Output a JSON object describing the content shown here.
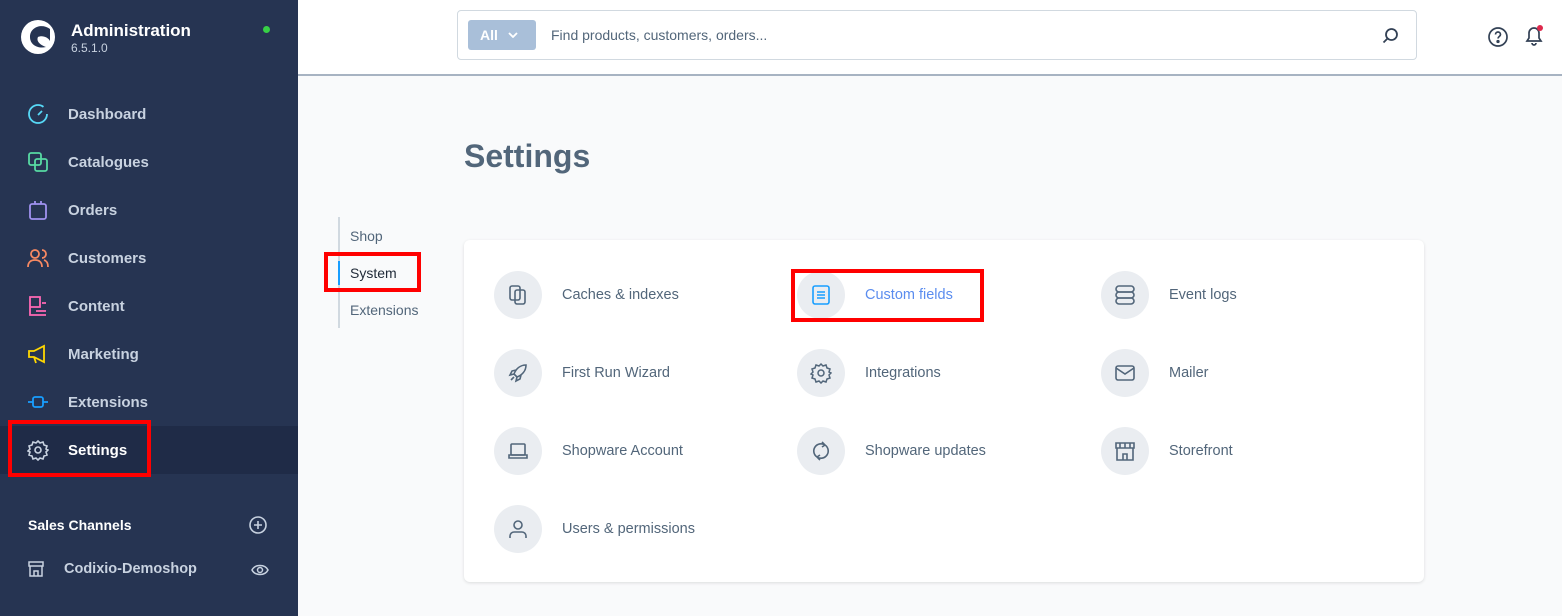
{
  "app": {
    "title": "Administration",
    "version": "6.5.1.0",
    "status_color": "#37d046"
  },
  "sidebar": {
    "items": [
      {
        "label": "Dashboard",
        "icon": "dashboard-icon",
        "color": "#57d9f7"
      },
      {
        "label": "Catalogues",
        "icon": "catalogues-icon",
        "color": "#57d9a3"
      },
      {
        "label": "Orders",
        "icon": "orders-icon",
        "color": "#a092f0"
      },
      {
        "label": "Customers",
        "icon": "customers-icon",
        "color": "#f88962"
      },
      {
        "label": "Content",
        "icon": "content-icon",
        "color": "#ff68b4"
      },
      {
        "label": "Marketing",
        "icon": "marketing-icon",
        "color": "#ffd700"
      },
      {
        "label": "Extensions",
        "icon": "extensions-icon",
        "color": "#189eff"
      },
      {
        "label": "Settings",
        "icon": "gear-icon",
        "color": "#c8d2e0",
        "active": true
      }
    ],
    "sales_channels": {
      "title": "Sales Channels",
      "items": [
        {
          "label": "Codixio-Demoshop"
        }
      ]
    }
  },
  "header": {
    "search": {
      "type": "All",
      "placeholder": "Find products, customers, orders..."
    }
  },
  "main": {
    "title": "Settings",
    "tabs": [
      {
        "label": "Shop"
      },
      {
        "label": "System",
        "active": true
      },
      {
        "label": "Extensions"
      }
    ],
    "tiles": [
      {
        "label": "Caches & indexes",
        "icon": "caches-icon"
      },
      {
        "label": "Custom fields",
        "icon": "custom-fields-icon",
        "highlighted": true
      },
      {
        "label": "Event logs",
        "icon": "event-logs-icon"
      },
      {
        "label": "First Run Wizard",
        "icon": "rocket-icon"
      },
      {
        "label": "Integrations",
        "icon": "gear-icon"
      },
      {
        "label": "Mailer",
        "icon": "mail-icon"
      },
      {
        "label": "Shopware Account",
        "icon": "laptop-icon"
      },
      {
        "label": "Shopware updates",
        "icon": "refresh-icon"
      },
      {
        "label": "Storefront",
        "icon": "storefront-icon"
      },
      {
        "label": "Users & permissions",
        "icon": "user-icon"
      }
    ]
  },
  "accent": "#189eff",
  "highlight_color": "#ff0000"
}
